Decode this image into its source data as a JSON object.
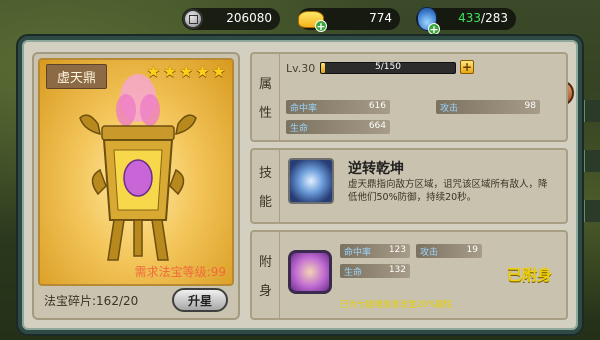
{
  "resources": {
    "coins": "206080",
    "ingots": "774",
    "energy_current": "433",
    "energy_max": "283"
  },
  "treasure": {
    "name": "虚天鼎",
    "stars": 5,
    "requirement": "需求法宝等级:99",
    "shards_label": "法宝碎片:162/20",
    "upgrade_label": "升星"
  },
  "attributes": {
    "section_label_1": "属",
    "section_label_2": "性",
    "level": "Lv.30",
    "xp": "5/150",
    "xp_fraction": 0.033,
    "stats": [
      {
        "key": "命中率",
        "value": "616"
      },
      {
        "key": "攻击",
        "value": "98"
      },
      {
        "key": "生命",
        "value": "664"
      }
    ]
  },
  "skill": {
    "section_label_1": "技",
    "section_label_2": "能",
    "name": "逆转乾坤",
    "description": "虚天鼎指向敌方区域，诅咒该区域所有敌人，降低他们50%防御，持续20秒。"
  },
  "attach": {
    "section_label_1": "附",
    "section_label_2": "身",
    "stats": [
      {
        "key": "命中率",
        "value": "123"
      },
      {
        "key": "攻击",
        "value": "19"
      },
      {
        "key": "生命",
        "value": "132"
      }
    ],
    "status": "已附身",
    "bonus": "已为七娃增加该法宝20%属性."
  },
  "colors": {
    "frame": "#2e4a45",
    "panel": "#d3cfc1",
    "gold": "#ffcf1a",
    "stat_key": "#9bd5ff",
    "attached": "#f0d000"
  }
}
